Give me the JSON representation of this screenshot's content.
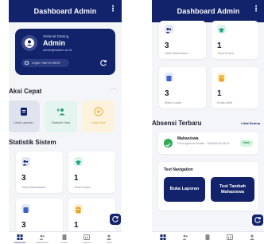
{
  "app": {
    "title": "Dashboard Admin",
    "menu_icon": "more-vert-icon"
  },
  "profile": {
    "welcome": "Selamat Datang,",
    "name": "Admin",
    "email": "admin@sistem.ac.id",
    "last_login": "Login: Hari ini 08:00"
  },
  "quick_actions": {
    "title": "Aksi Cepat",
    "more": "···",
    "items": [
      {
        "label": "Lihat Laporan",
        "icon": "document-icon",
        "bg": "#dfe3ee",
        "color": "#12236b"
      },
      {
        "label": "Tambah User",
        "icon": "add-user-icon",
        "bg": "#e4f4ef",
        "color": "#2a9a7a"
      },
      {
        "label": "Lihat Notif",
        "icon": "plus-circle-icon",
        "bg": "#fdf3dc",
        "color": "#e6a82a"
      }
    ]
  },
  "stats": {
    "title": "Statistik Sistem",
    "cards": [
      {
        "value": "3",
        "label": "Total Mahasiswa",
        "icon": "people-icon",
        "bg": "#e3e7f3",
        "color": "#12236b"
      },
      {
        "value": "1",
        "label": "Total Dosen",
        "icon": "school-icon",
        "bg": "#dff3ee",
        "color": "#22a38a"
      },
      {
        "value": "3",
        "label": "Mata Kuliah",
        "icon": "book-icon",
        "bg": "#e2eaf8",
        "color": "#3b62c4"
      },
      {
        "value": "1",
        "label": "Kelas Aktif",
        "icon": "class-icon",
        "bg": "#fdf1d6",
        "color": "#e8a523"
      }
    ]
  },
  "attendance": {
    "title": "Absensi Terbaru",
    "see_all": "Lihat Semua",
    "item": {
      "name": "Mahasiswa",
      "detail": "Pemrograman Mobile - 25/06/2025 08:30",
      "status": "Hadir"
    }
  },
  "test_navigation": {
    "title": "Test Navigation",
    "buttons": [
      "Buka Laporan",
      "Test Tambah Mahasiswa"
    ]
  },
  "nav": {
    "items": [
      {
        "label": "Dashboard",
        "icon": "grid-icon"
      },
      {
        "label": "Mahasiswa",
        "icon": "people-icon"
      },
      {
        "label": "Dosen",
        "icon": "document-icon"
      },
      {
        "label": "Laporan",
        "icon": "chart-icon"
      },
      {
        "label": "Profil",
        "icon": "person-icon"
      }
    ]
  },
  "colors": {
    "primary": "#12236b",
    "success": "#2faa59",
    "background": "#f4f5f8"
  }
}
